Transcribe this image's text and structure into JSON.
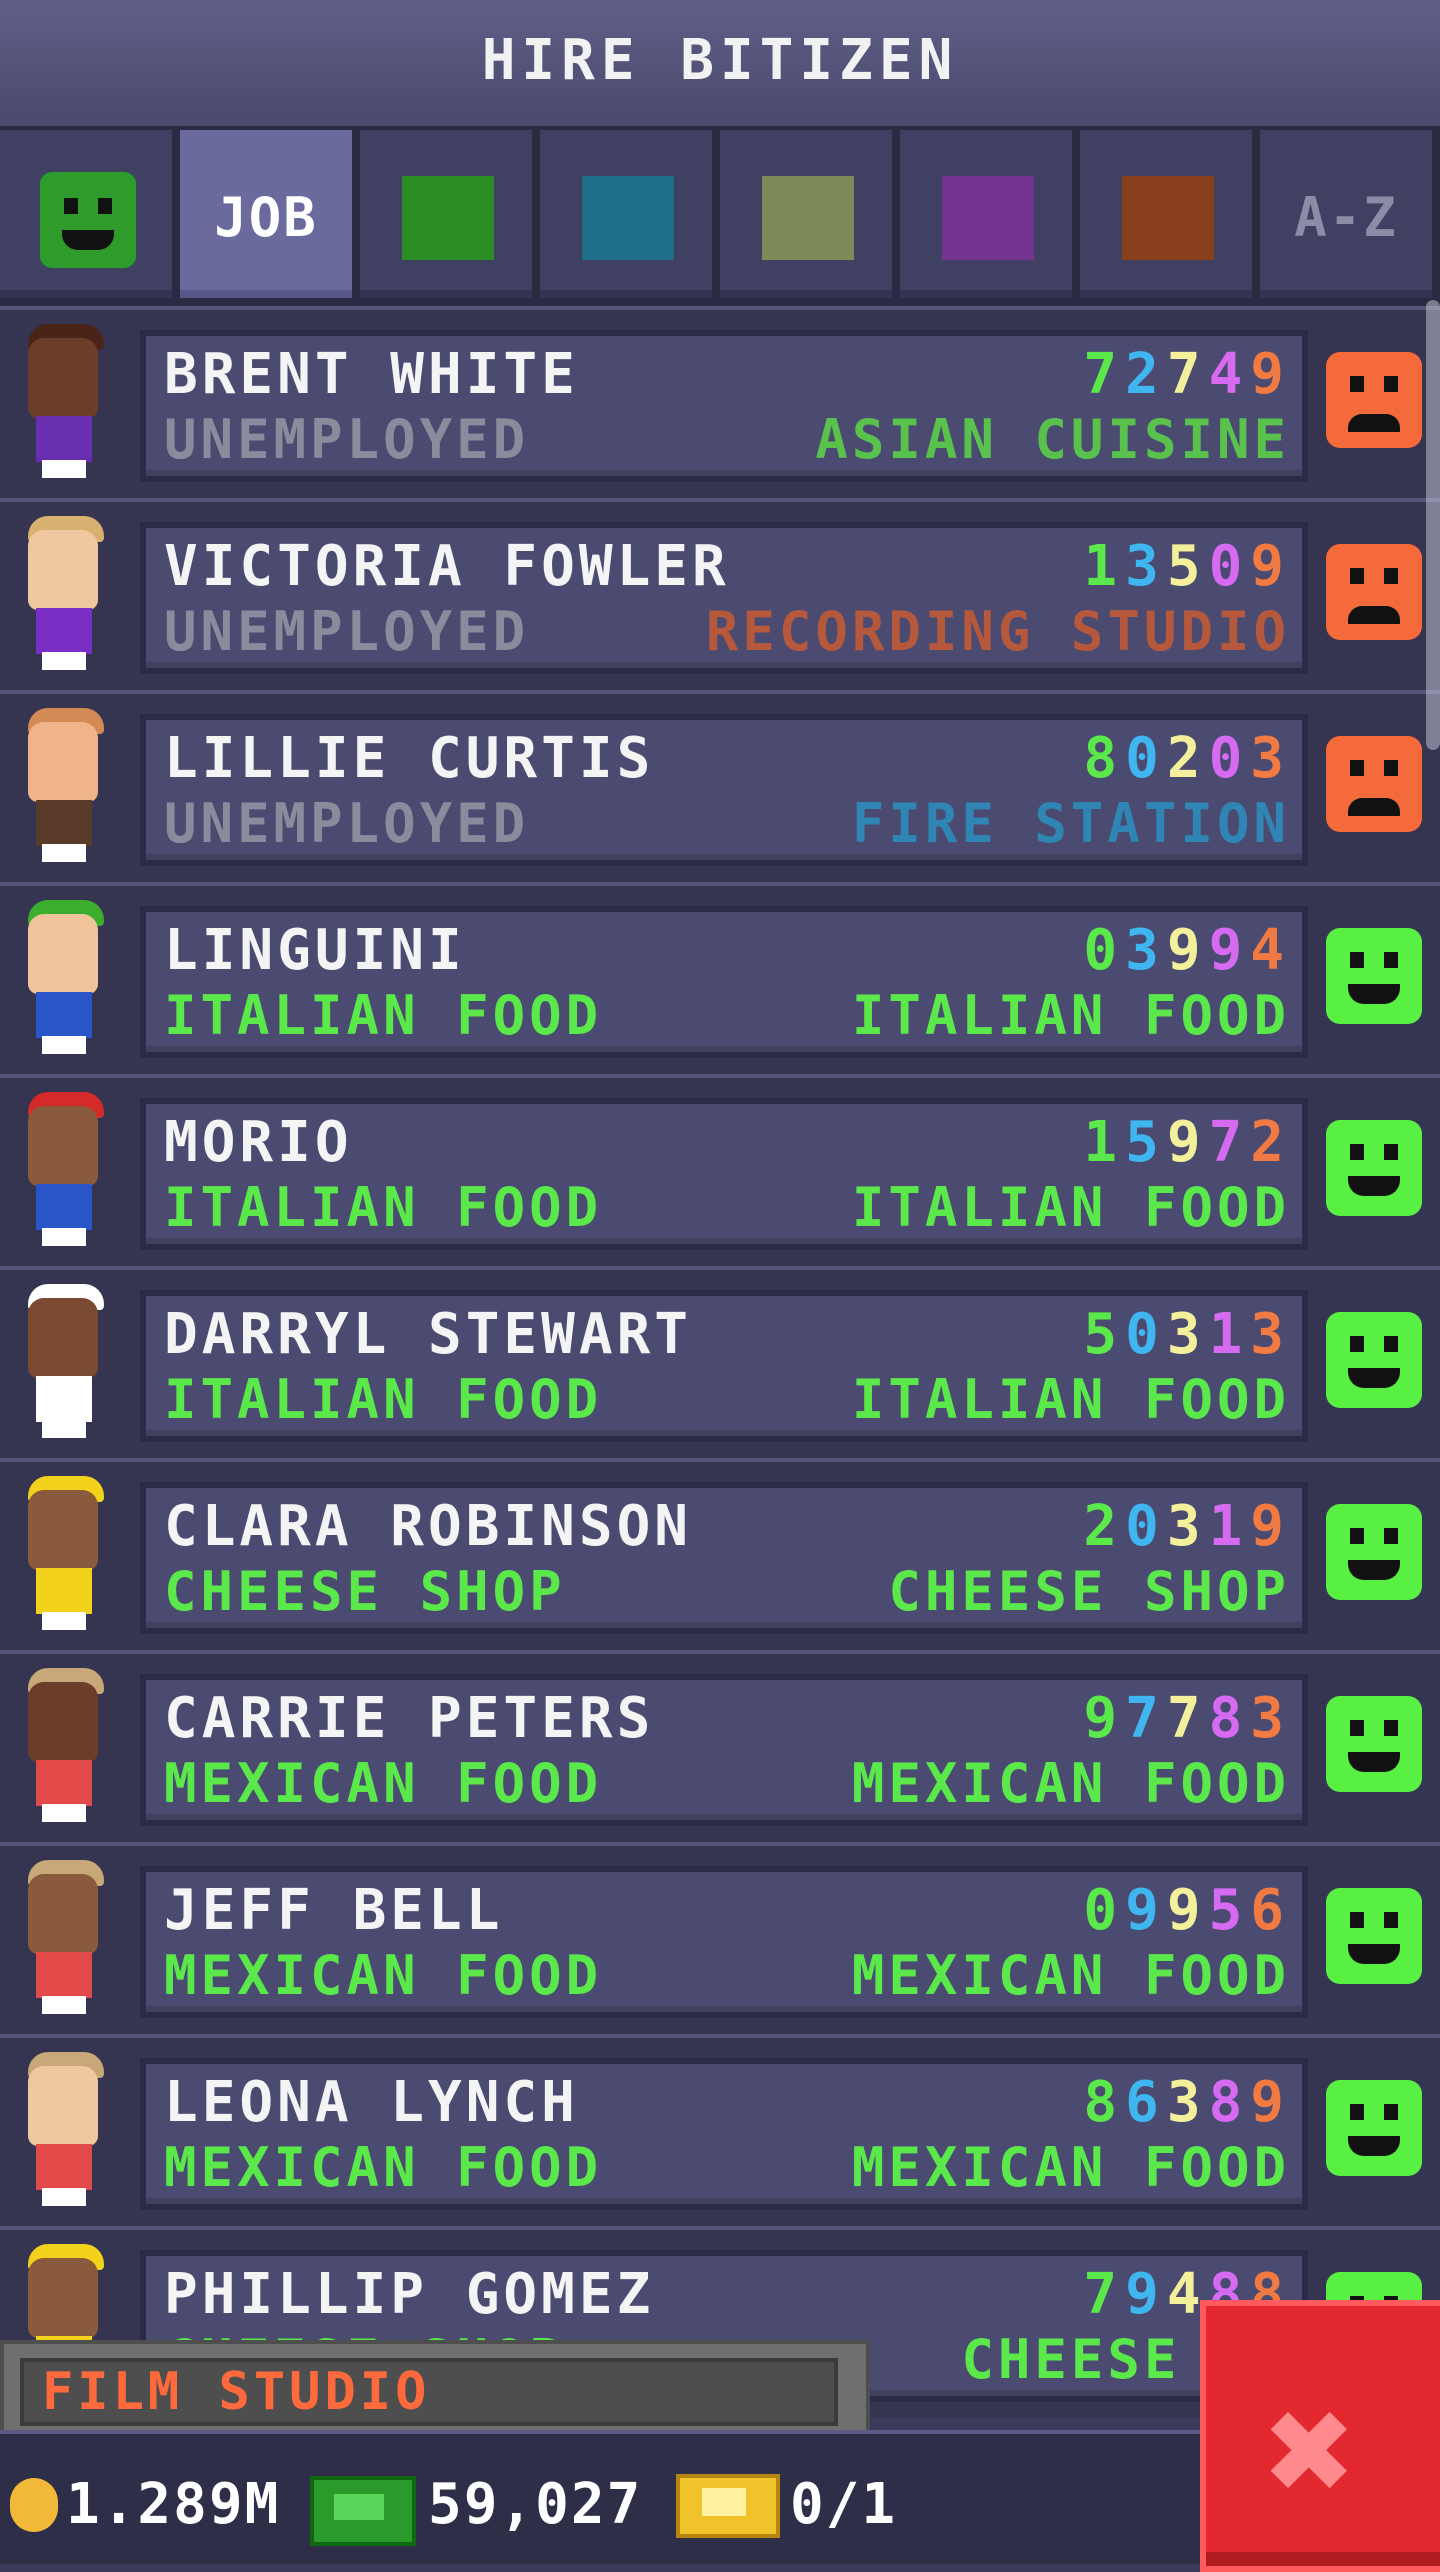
{
  "header": {
    "title": "HIRE BITIZEN"
  },
  "tabs": [
    {
      "type": "icon",
      "icon": "happy-face-icon",
      "color": "#2e9b2a"
    },
    {
      "type": "text",
      "label": "JOB",
      "active": true
    },
    {
      "type": "swatch",
      "color": "#2c8c26"
    },
    {
      "type": "swatch",
      "color": "#1f6e88"
    },
    {
      "type": "swatch",
      "color": "#7e8a58"
    },
    {
      "type": "swatch",
      "color": "#75348f"
    },
    {
      "type": "swatch",
      "color": "#8a3f1c"
    },
    {
      "type": "text",
      "label": "A-Z",
      "dim": true
    }
  ],
  "rows": [
    {
      "name": "BRENT WHITE",
      "job": "UNEMPLOYED",
      "job_color": "#8b8b9e",
      "dream": "ASIAN CUISINE",
      "dream_color": "#59c24c",
      "stats": [
        "7",
        "2",
        "7",
        "4",
        "9"
      ],
      "mood": "sad",
      "skin": "#6b3e2a",
      "shirt": "#6a2fb0",
      "hair": "#4a2416"
    },
    {
      "name": "VICTORIA FOWLER",
      "job": "UNEMPLOYED",
      "job_color": "#8b8b9e",
      "dream": "RECORDING STUDIO",
      "dream_color": "#b5583c",
      "stats": [
        "1",
        "3",
        "5",
        "0",
        "9"
      ],
      "mood": "sad",
      "skin": "#f0c8a0",
      "shirt": "#7a2fc4",
      "hair": "#d8b070"
    },
    {
      "name": "LILLIE CURTIS",
      "job": "UNEMPLOYED",
      "job_color": "#8b8b9e",
      "dream": "FIRE STATION",
      "dream_color": "#2f86b4",
      "stats": [
        "8",
        "0",
        "2",
        "0",
        "3"
      ],
      "mood": "sad",
      "skin": "#f0b48a",
      "shirt": "#5a3a28",
      "hair": "#d48a54"
    },
    {
      "name": "LINGUINI",
      "job": "ITALIAN FOOD",
      "job_color": "#5be84a",
      "dream": "ITALIAN FOOD",
      "dream_color": "#5be84a",
      "stats": [
        "0",
        "3",
        "9",
        "9",
        "4"
      ],
      "mood": "happy",
      "skin": "#f0c49a",
      "shirt": "#2a55c8",
      "hair": "#3cae2e"
    },
    {
      "name": "MORIO",
      "job": "ITALIAN FOOD",
      "job_color": "#5be84a",
      "dream": "ITALIAN FOOD",
      "dream_color": "#5be84a",
      "stats": [
        "1",
        "5",
        "9",
        "7",
        "2"
      ],
      "mood": "happy",
      "skin": "#8a5a3c",
      "shirt": "#2a55c8",
      "hair": "#d42a2a"
    },
    {
      "name": "DARRYL STEWART",
      "job": "ITALIAN FOOD",
      "job_color": "#5be84a",
      "dream": "ITALIAN FOOD",
      "dream_color": "#5be84a",
      "stats": [
        "5",
        "0",
        "3",
        "1",
        "3"
      ],
      "mood": "happy",
      "skin": "#7a4a32",
      "shirt": "#ffffff",
      "hair": "#ffffff"
    },
    {
      "name": "CLARA ROBINSON",
      "job": "CHEESE SHOP",
      "job_color": "#5be84a",
      "dream": "CHEESE SHOP",
      "dream_color": "#5be84a",
      "stats": [
        "2",
        "0",
        "3",
        "1",
        "9"
      ],
      "mood": "happy",
      "skin": "#8a5a3c",
      "shirt": "#f2d21a",
      "hair": "#f2d21a"
    },
    {
      "name": "CARRIE PETERS",
      "job": "MEXICAN FOOD",
      "job_color": "#5be84a",
      "dream": "MEXICAN FOOD",
      "dream_color": "#5be84a",
      "stats": [
        "9",
        "7",
        "7",
        "8",
        "3"
      ],
      "mood": "happy",
      "skin": "#6b3e2a",
      "shirt": "#e24a4a",
      "hair": "#c8a878"
    },
    {
      "name": "JEFF BELL",
      "job": "MEXICAN FOOD",
      "job_color": "#5be84a",
      "dream": "MEXICAN FOOD",
      "dream_color": "#5be84a",
      "stats": [
        "0",
        "9",
        "9",
        "5",
        "6"
      ],
      "mood": "happy",
      "skin": "#8a5a3c",
      "shirt": "#e24a4a",
      "hair": "#c8a878"
    },
    {
      "name": "LEONA LYNCH",
      "job": "MEXICAN FOOD",
      "job_color": "#5be84a",
      "dream": "MEXICAN FOOD",
      "dream_color": "#5be84a",
      "stats": [
        "8",
        "6",
        "3",
        "8",
        "9"
      ],
      "mood": "happy",
      "skin": "#f0c8a0",
      "shirt": "#e24a4a",
      "hair": "#c8a878"
    },
    {
      "name": "PHILLIP GOMEZ",
      "job": "CHEESE SHOP",
      "job_color": "#5be84a",
      "dream": "CHEESE SH",
      "dream_color": "#5be84a",
      "stats": [
        "7",
        "9",
        "4",
        "8",
        "8"
      ],
      "mood": "happy",
      "skin": "#8a5a3c",
      "shirt": "#f2d21a",
      "hair": "#f2d21a"
    }
  ],
  "stat_colors": [
    "#5be84a",
    "#3fb6f0",
    "#f4ef9a",
    "#d66af0",
    "#f07a42"
  ],
  "bottom_panel": {
    "label": "FILM STUDIO"
  },
  "statusbar": {
    "coins": "1.289M",
    "bux": "59,027",
    "vip": "0/1",
    "coin_icon": "coin-icon",
    "bux_icon": "bux-icon",
    "vip_icon": "vip-ticket-icon"
  },
  "close_button": {
    "label": "✖"
  }
}
